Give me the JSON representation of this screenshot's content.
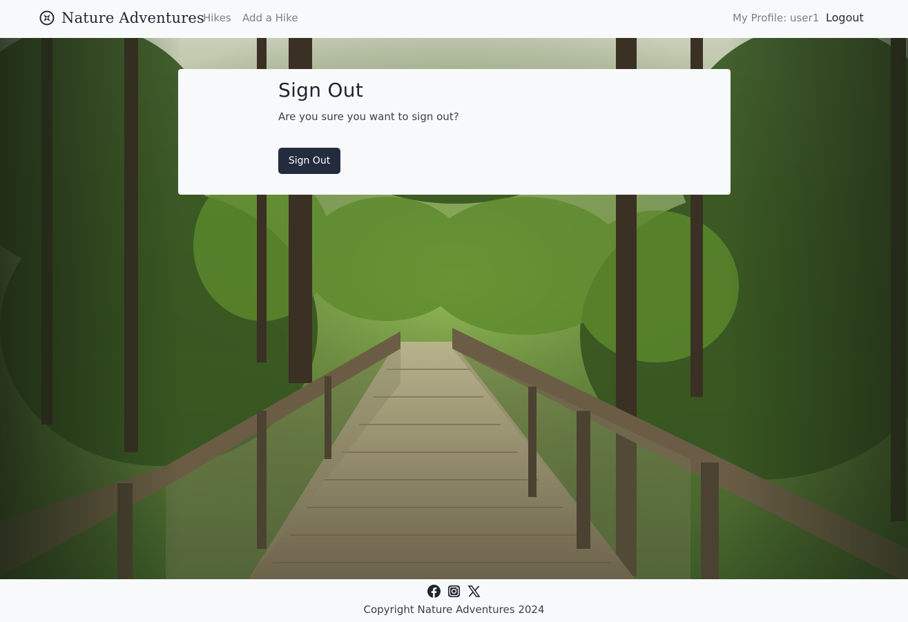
{
  "navbar": {
    "brand": "Nature Adventures",
    "brand_icon": "compass-icon",
    "links": {
      "hikes": "Hikes",
      "add_hike": "Add a Hike",
      "profile": "My Profile: user1",
      "logout": "Logout"
    }
  },
  "signout": {
    "title": "Sign Out",
    "prompt": "Are you sure you want to sign out?",
    "button_label": "Sign Out"
  },
  "footer": {
    "social_icons": [
      "facebook-icon",
      "instagram-icon",
      "x-icon"
    ],
    "copyright": "Copyright Nature Adventures 2024"
  },
  "colors": {
    "primary_button": "#232c3e",
    "background": "#f8f9fb",
    "text_dark": "#1f2430",
    "nav_muted": "#7a7f86"
  }
}
